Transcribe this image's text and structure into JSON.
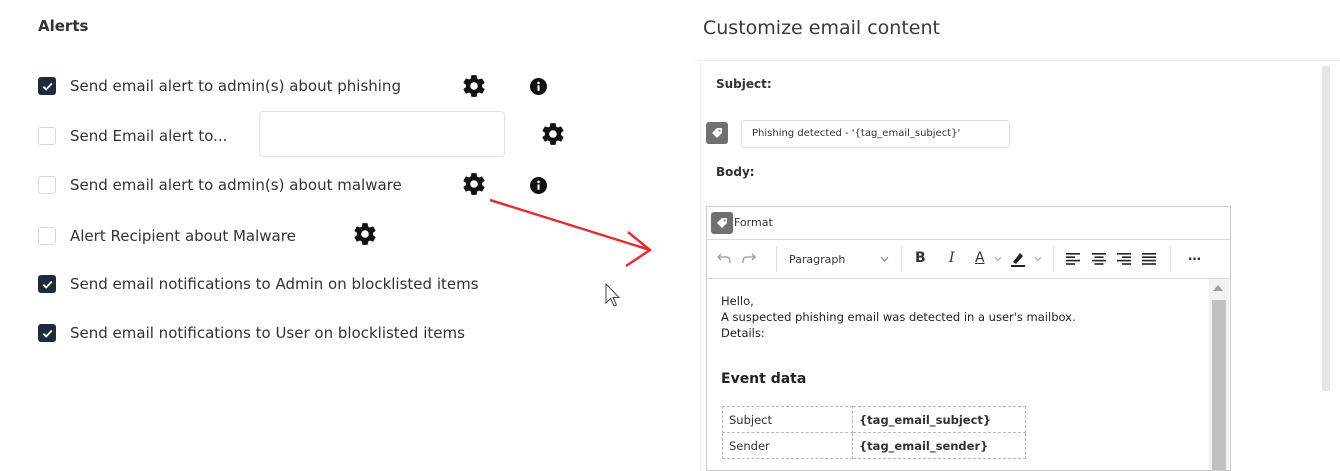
{
  "alerts": {
    "title": "Alerts",
    "items": [
      {
        "label": "Send email alert to admin(s) about phishing",
        "checked": true
      },
      {
        "label": "Send Email alert to...",
        "checked": false
      },
      {
        "label": "Send email alert to admin(s) about malware",
        "checked": false
      },
      {
        "label": "Alert Recipient about Malware",
        "checked": false
      },
      {
        "label": "Send email notifications to Admin on blocklisted items",
        "checked": true
      },
      {
        "label": "Send email notifications to User on blocklisted items",
        "checked": true
      }
    ],
    "recipient_input": {
      "value": "",
      "placeholder": ""
    }
  },
  "customize": {
    "title": "Customize email content",
    "subject_label": "Subject:",
    "subject_value": "Phishing detected - '{tag_email_subject}'",
    "body_label": "Body:",
    "format_label": "Format",
    "toolbar": {
      "paragraph_select": "Paragraph",
      "bold": "B",
      "italic": "I",
      "font_color": "A",
      "more": "…"
    },
    "body": {
      "lines": [
        "Hello,",
        "A suspected phishing email was detected in a user's mailbox.",
        "Details:"
      ],
      "event_heading": "Event data",
      "table": [
        {
          "key": "Subject",
          "value": "{tag_email_subject}"
        },
        {
          "key": "Sender",
          "value": "{tag_email_sender}"
        }
      ]
    }
  },
  "colors": {
    "checkbox_checked": "#1d2b3a",
    "arrow": "#e03030",
    "tag_button": "#707070"
  }
}
